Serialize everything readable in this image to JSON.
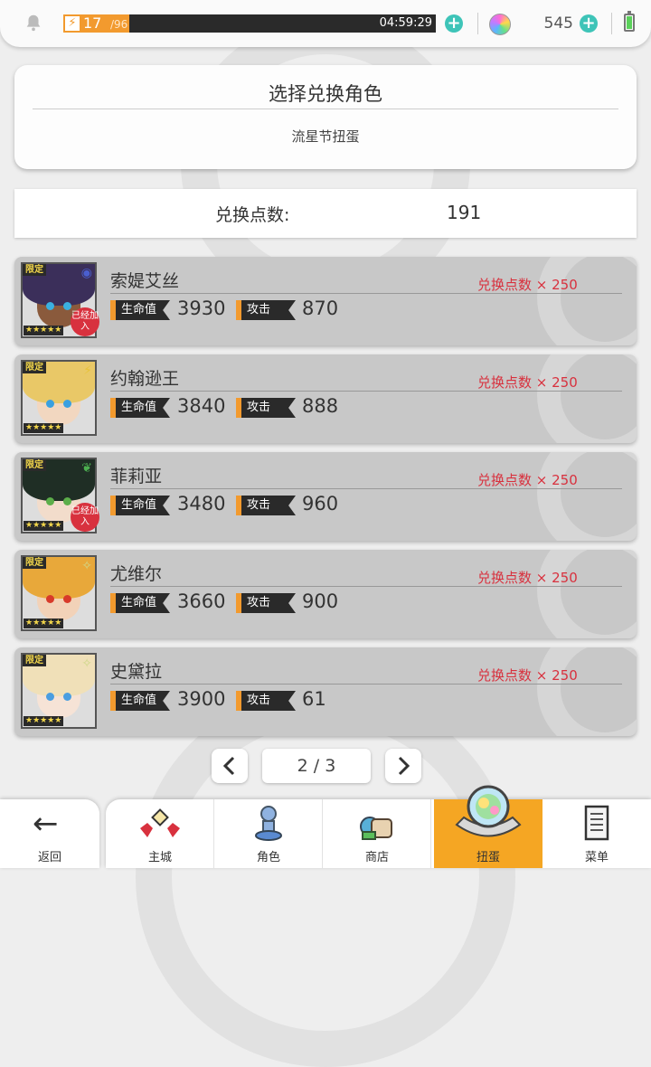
{
  "status_bar": {
    "stamina_current": "17",
    "stamina_max": "/96",
    "stamina_fraction": 0.177,
    "timer": "04:59:29",
    "gems": "545"
  },
  "header": {
    "title": "选择兑换角色",
    "subtitle": "流星节扭蛋"
  },
  "points": {
    "label": "兑换点数:",
    "value": "191"
  },
  "characters": [
    {
      "name": "索媞艾丝",
      "hp_label": "生命值",
      "hp": "3930",
      "atk_label": "攻击",
      "atk": "870",
      "cost": "兑换点数 × 250",
      "limited": "限定",
      "stars": "★★★★★",
      "joined": "已经加入",
      "element_icon": "water-icon",
      "accent": "#4a5fd0",
      "hair": "#3b2f5a",
      "skin": "#8a5a3c",
      "eye": "#3ab0e0"
    },
    {
      "name": "约翰逊王",
      "hp_label": "生命值",
      "hp": "3840",
      "atk_label": "攻击",
      "atk": "888",
      "cost": "兑换点数 × 250",
      "limited": "限定",
      "stars": "★★★★★",
      "joined": "",
      "element_icon": "lightning-icon",
      "accent": "#e8c23a",
      "hair": "#e9c867",
      "skin": "#f2d7c0",
      "eye": "#3aa0e0"
    },
    {
      "name": "菲莉亚",
      "hp_label": "生命值",
      "hp": "3480",
      "atk_label": "攻击",
      "atk": "960",
      "cost": "兑换点数 × 250",
      "limited": "限定",
      "stars": "★★★★★",
      "joined": "已经加入",
      "element_icon": "leaf-icon",
      "accent": "#4caf50",
      "hair": "#1f2e25",
      "skin": "#f2dccb",
      "eye": "#5cae4a"
    },
    {
      "name": "尤维尔",
      "hp_label": "生命值",
      "hp": "3660",
      "atk_label": "攻击",
      "atk": "900",
      "cost": "兑换点数 × 250",
      "limited": "限定",
      "stars": "★★★★★",
      "joined": "",
      "element_icon": "sparkle-icon",
      "accent": "#cfd88a",
      "hair": "#e8a83a",
      "skin": "#f2d2b8",
      "eye": "#d83a2a"
    },
    {
      "name": "史黛拉",
      "hp_label": "生命值",
      "hp": "3900",
      "atk_label": "攻击",
      "atk": "61",
      "cost": "兑换点数 × 250",
      "limited": "限定",
      "stars": "★★★★★",
      "joined": "",
      "element_icon": "sparkle-icon",
      "accent": "#cfd88a",
      "hair": "#f0e0b8",
      "skin": "#f6e3d6",
      "eye": "#4a9ee0"
    }
  ],
  "pager": {
    "prev_icon": "‹",
    "next_icon": "›",
    "label": "2 / 3"
  },
  "nav": {
    "back": "返回",
    "items": [
      {
        "label": "主城",
        "icon": "castle-icon"
      },
      {
        "label": "角色",
        "icon": "character-icon"
      },
      {
        "label": "商店",
        "icon": "shop-icon"
      },
      {
        "label": "扭蛋",
        "icon": "gacha-icon",
        "active": true
      },
      {
        "label": "菜单",
        "icon": "menu-icon"
      }
    ]
  }
}
